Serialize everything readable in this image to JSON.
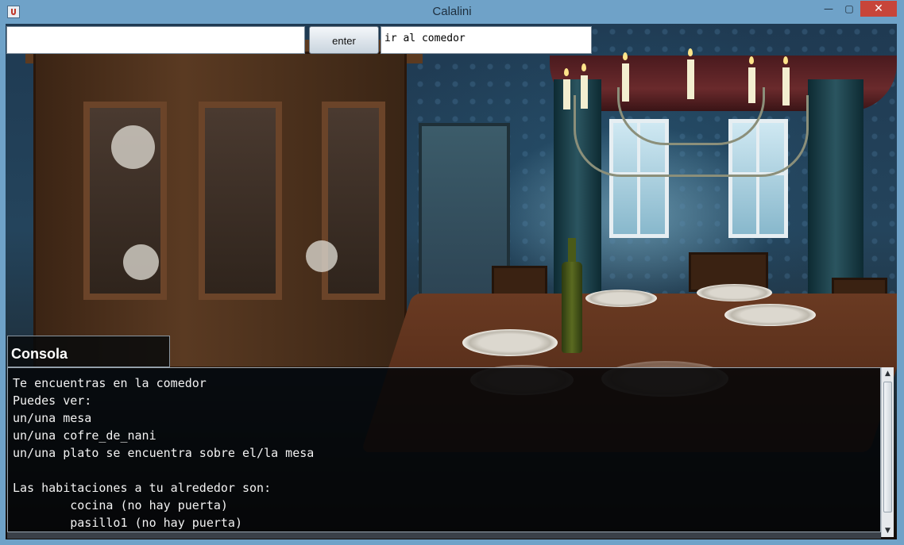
{
  "window": {
    "title": "Calalini",
    "minimize_glyph": "—",
    "maximize_glyph": "▢",
    "close_glyph": "✕"
  },
  "toolbar": {
    "command_input_value": "",
    "enter_label": "enter",
    "last_command": "ir al comedor"
  },
  "console": {
    "label": "Consola",
    "lines": [
      "Te encuentras en la comedor",
      "Puedes ver:",
      "un/una mesa",
      "un/una cofre_de_nani",
      "un/una plato se encuentra sobre el/la mesa",
      "",
      "Las habitaciones a tu alrededor son:",
      "        cocina (no hay puerta)",
      "        pasillo1 (no hay puerta)"
    ]
  },
  "scrollbar": {
    "up_glyph": "▲",
    "down_glyph": "▼"
  },
  "icons": {
    "app": "java-app-icon",
    "minimize": "minimize-icon",
    "maximize": "maximize-icon",
    "close": "close-icon"
  }
}
